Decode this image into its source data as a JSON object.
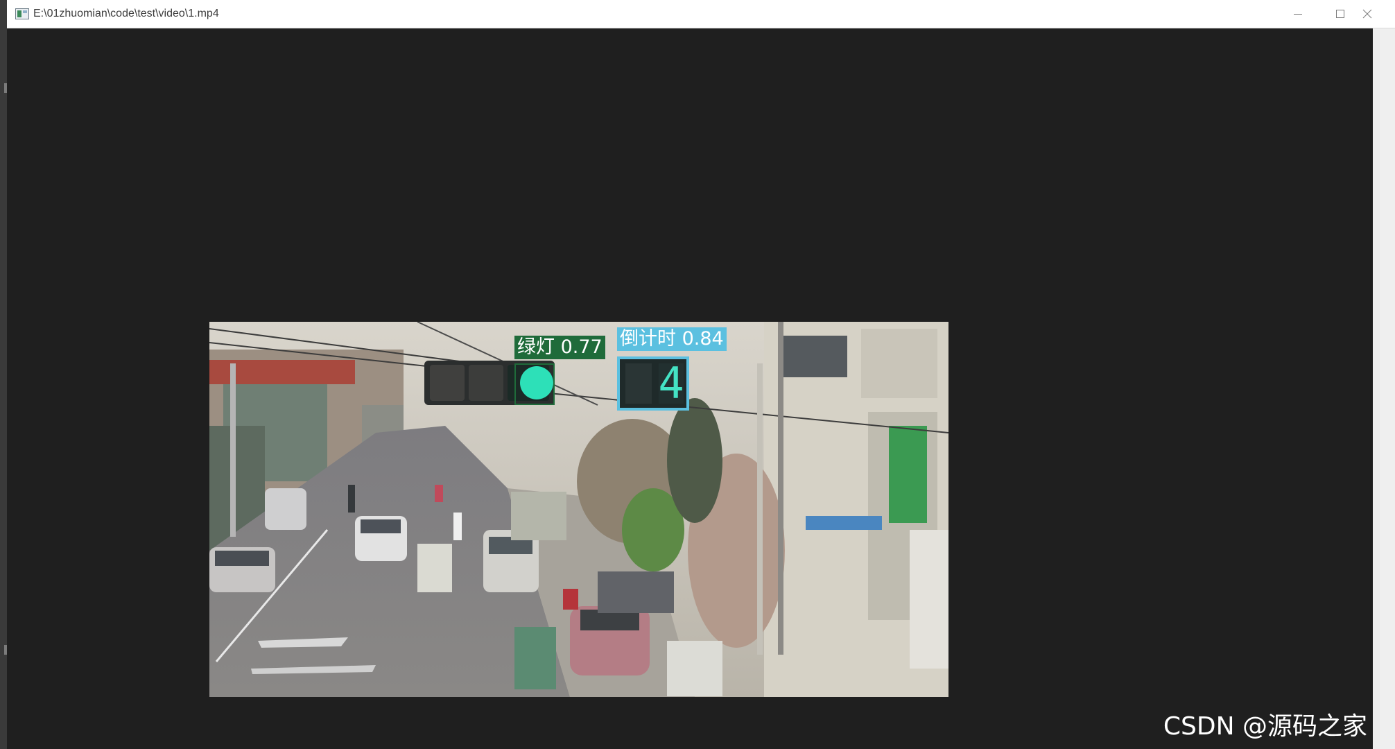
{
  "window": {
    "title": "E:\\01zhuomian\\code\\test\\video\\1.mp4",
    "controls": {
      "minimize_icon": "minimize-icon",
      "maximize_icon": "maximize-icon",
      "close_icon": "close-icon"
    }
  },
  "detections": [
    {
      "label": "绿灯 0.77",
      "class": "绿灯",
      "confidence": 0.77,
      "color": "#1f6b3a"
    },
    {
      "label": "倒计时 0.84",
      "class": "倒计时",
      "confidence": 0.84,
      "color": "#5bc0e0"
    }
  ],
  "countdown_display": "4",
  "watermark": "CSDN @源码之家",
  "colors": {
    "background": "#1f1f1f",
    "green_light": "#2de0b8",
    "green_box": "#1f6b3a",
    "countdown_box": "#5bc0e0"
  }
}
